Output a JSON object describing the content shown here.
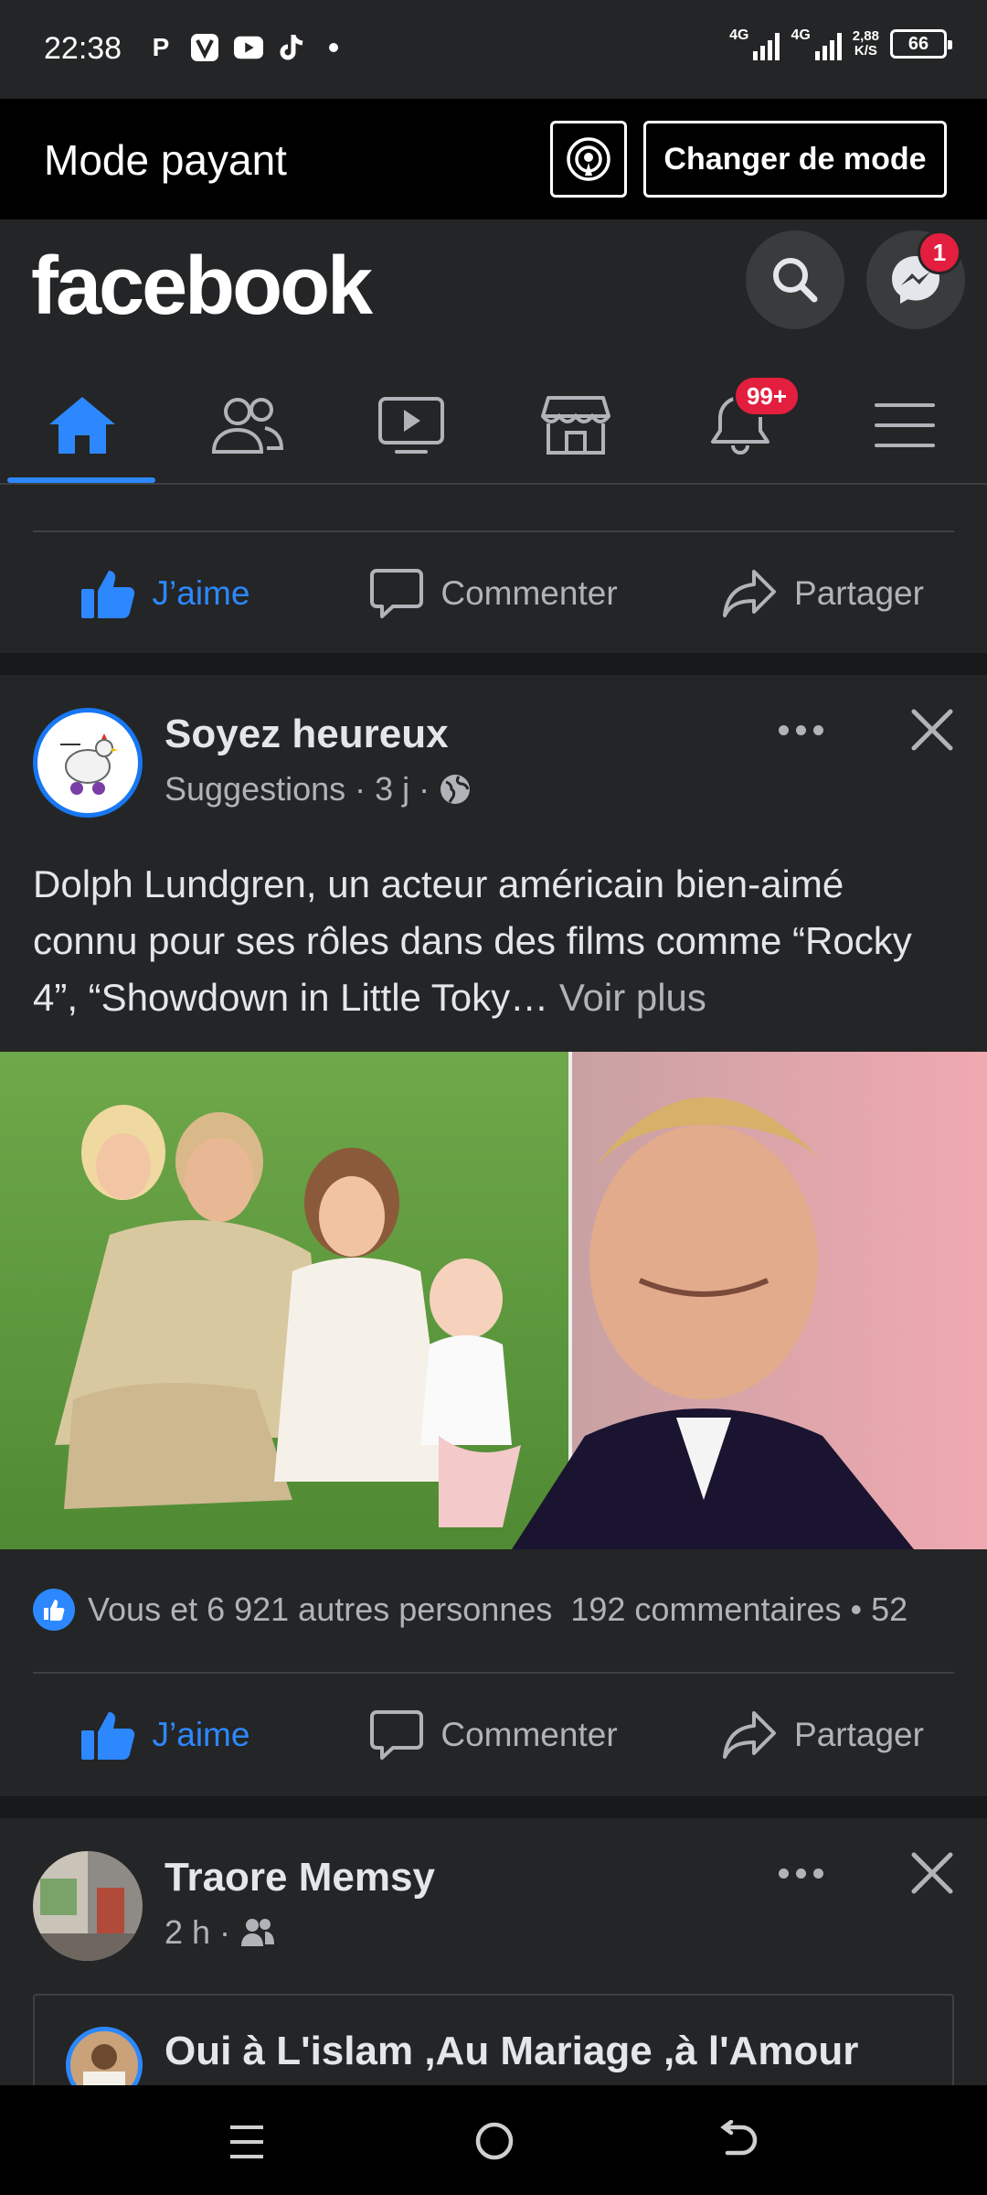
{
  "status_bar": {
    "time": "22:38",
    "apps": [
      "P",
      "V",
      "youtube-icon",
      "tiktok-icon"
    ],
    "net1": "4G",
    "net2": "4G",
    "speed_value": "2,88",
    "speed_unit": "K/S",
    "battery": "66"
  },
  "mode_bar": {
    "title": "Mode payant",
    "change_label": "Changer de mode"
  },
  "header": {
    "logo": "facebook",
    "messenger_badge": "1",
    "notifications_badge": "99+",
    "nav": [
      "home-icon",
      "friends-icon",
      "watch-icon",
      "marketplace-icon",
      "notifications-icon",
      "menu-icon"
    ],
    "active_tab": "home"
  },
  "prev_post": {
    "actions": {
      "like": "J’aime",
      "comment": "Commenter",
      "share": "Partager"
    }
  },
  "post1": {
    "author": "Soyez heureux",
    "meta": "Suggestions · 3 j ·",
    "text": "Dolph Lundgren, un acteur américain bien-aimé connu pour ses rôles dans des films comme “Rocky 4”, “Showdown in Little Toky…",
    "see_more": "Voir plus",
    "reactions_text": "Vous et 6 921 autres personnes",
    "comments_text": "192 commentaires • 52",
    "actions": {
      "like": "J’aime",
      "comment": "Commenter",
      "share": "Partager"
    }
  },
  "post2": {
    "author": "Traore Memsy",
    "meta": "2 h ·",
    "shared_title": "Oui à L'islam ,Au Mariage ,à l'Amour"
  },
  "colors": {
    "accent": "#2d88ff",
    "badge": "#e41e3f",
    "surface": "#242526",
    "background": "#18191a"
  }
}
